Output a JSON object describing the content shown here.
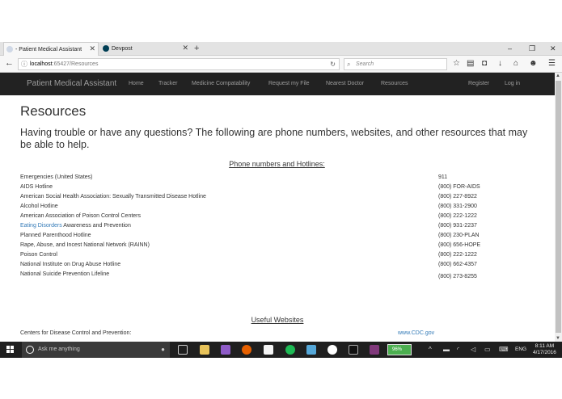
{
  "browser": {
    "tabs": [
      {
        "title": "- Patient Medical Assistant",
        "active": true
      },
      {
        "title": "Devpost",
        "active": false
      }
    ],
    "url": {
      "host": "localhost",
      "path": ":65427/Resources"
    },
    "search_placeholder": "Search",
    "window_controls": {
      "minimize": "–",
      "maximize": "❐",
      "close": "✕"
    }
  },
  "site_nav": {
    "brand": "Patient Medical Assistant",
    "links": [
      "Home",
      "Tracker",
      "Medicine Compatability",
      "Request my File",
      "Nearest Doctor",
      "Resources"
    ],
    "register": "Register",
    "login": "Log in"
  },
  "page": {
    "title": "Resources",
    "intro": "Having trouble or have any questions? The following are phone numbers, websites, and other resources that may be able to help.",
    "phone_section_title": "Phone numbers and Hotlines:",
    "hotlines": [
      {
        "name": "Emergencies (United States)",
        "phone": "911"
      },
      {
        "name": "AIDS Hotline",
        "phone": "(800) FOR-AIDS"
      },
      {
        "name": "American Social Health Association: Sexually Transmitted Disease Hotline",
        "phone": "(800) 227-8922"
      },
      {
        "name": "Alcohol Hotline",
        "phone": "(800) 331-2900"
      },
      {
        "name": "American Association of Poison Control Centers",
        "phone": "(800) 222-1222"
      },
      {
        "link": "Eating Disorders",
        "name": " Awareness and Prevention",
        "phone": "(800) 931-2237"
      },
      {
        "name": "Planned Parenthood Hotline",
        "phone": "(800) 230-PLAN"
      },
      {
        "name": "Rape, Abuse, and Incest National Network (RAINN)",
        "phone": "(800) 656-HOPE"
      },
      {
        "name": "Poison Control",
        "phone": "(800) 222-1222"
      },
      {
        "name": "National Institute on Drug Abuse Hotline",
        "phone": "(800) 662-4357"
      },
      {
        "name": "National Suicide Prevention Lifeline",
        "phone": "(800) 273-8255"
      }
    ],
    "websites_section_title": "Useful Websites",
    "websites": [
      {
        "name": "Centers for Disease Control and Prevention:",
        "site": "www.CDC.gov"
      }
    ]
  },
  "taskbar": {
    "search_placeholder": "Ask me anything",
    "battery": "96%",
    "language": "ENG",
    "time": "8:11 AM",
    "date": "4/17/2016"
  },
  "colors": {
    "navbar_bg": "#222222",
    "nav_text": "#9d9d9d",
    "link": "#337ab7",
    "taskbar_bg": "#1f1f1f"
  }
}
